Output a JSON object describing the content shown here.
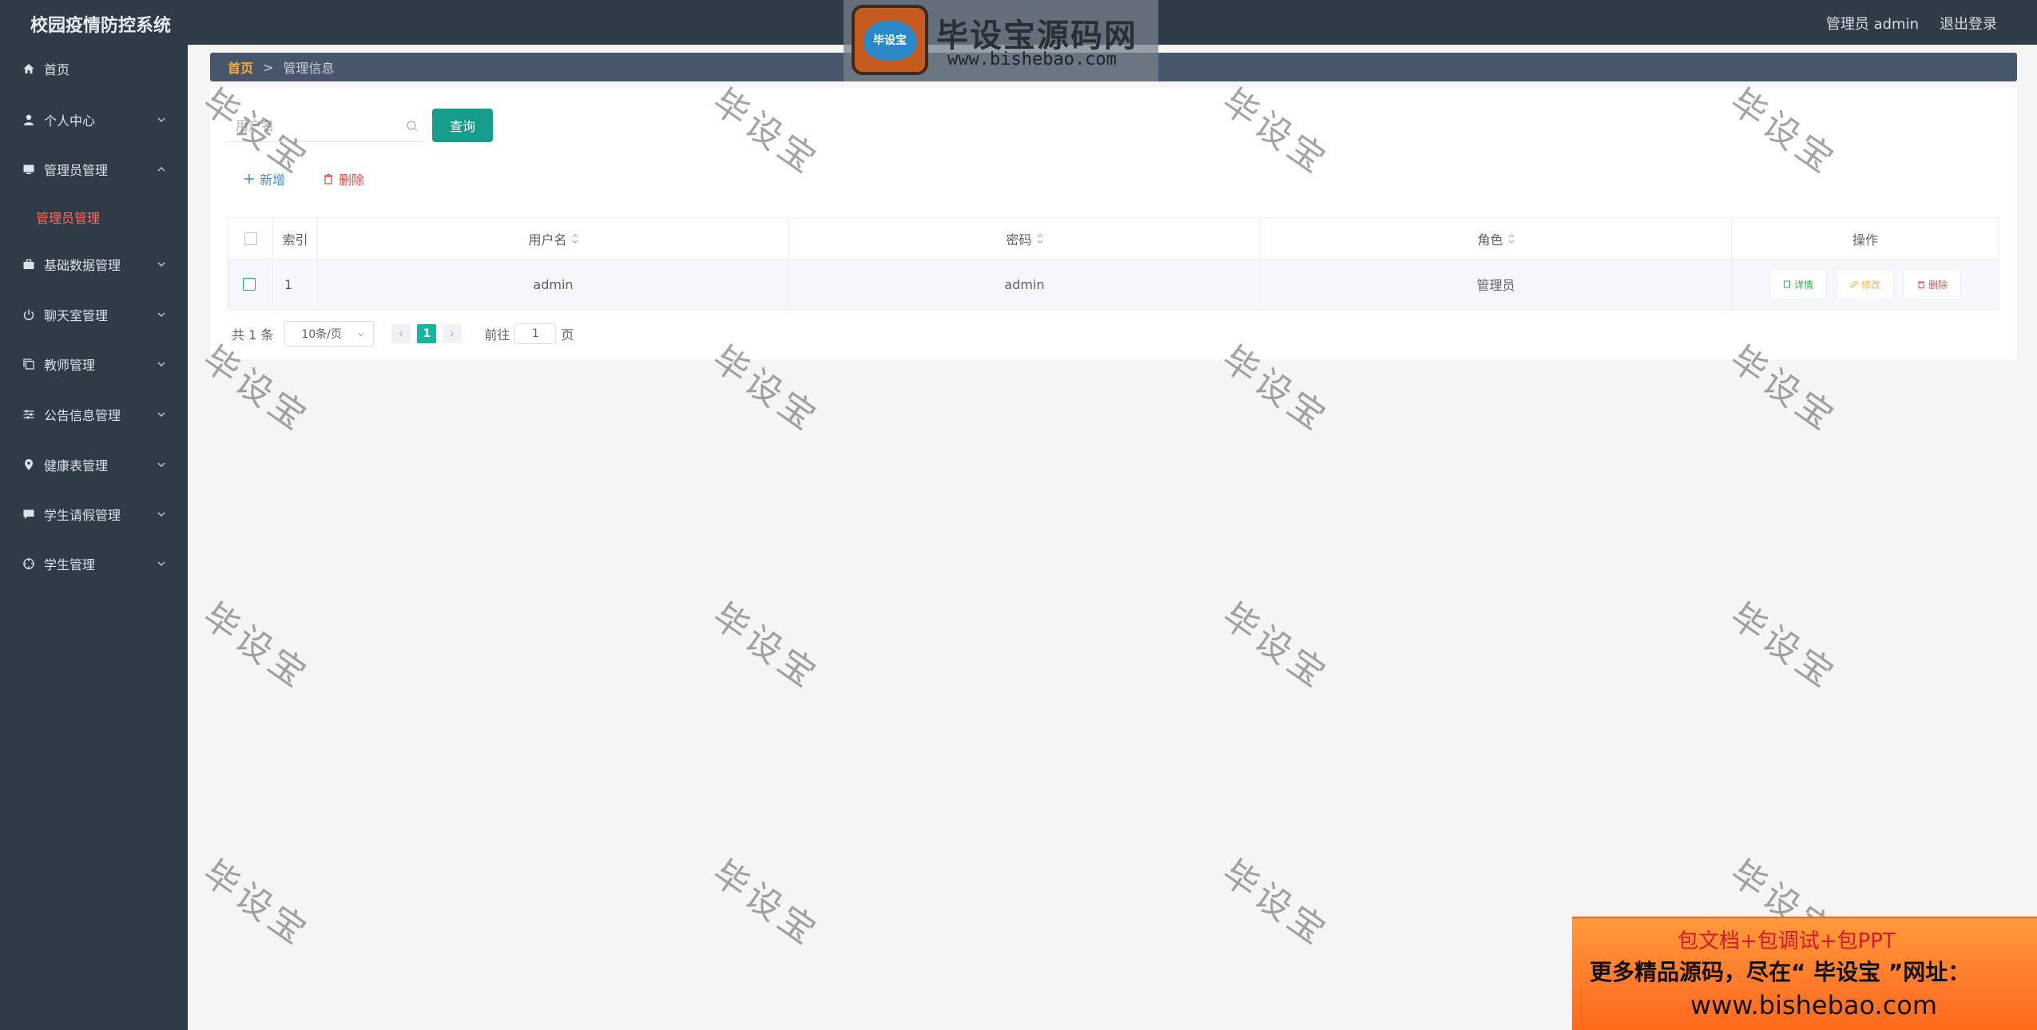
{
  "header": {
    "app_title": "校园疫情防控系统",
    "user_label": "管理员 admin",
    "logout_label": "退出登录"
  },
  "sidebar": {
    "items": [
      {
        "label": "首页",
        "icon": "home-icon",
        "has_chevron": false
      },
      {
        "label": "个人中心",
        "icon": "user-icon",
        "has_chevron": true
      },
      {
        "label": "管理员管理",
        "icon": "monitor-icon",
        "has_chevron": true,
        "expanded": true
      },
      {
        "label": "基础数据管理",
        "icon": "briefcase-icon",
        "has_chevron": true
      },
      {
        "label": "聊天室管理",
        "icon": "power-icon",
        "has_chevron": true
      },
      {
        "label": "教师管理",
        "icon": "copy-icon",
        "has_chevron": true
      },
      {
        "label": "公告信息管理",
        "icon": "sliders-icon",
        "has_chevron": true
      },
      {
        "label": "健康表管理",
        "icon": "location-icon",
        "has_chevron": true
      },
      {
        "label": "学生请假管理",
        "icon": "chat-icon",
        "has_chevron": true
      },
      {
        "label": "学生管理",
        "icon": "target-icon",
        "has_chevron": true
      }
    ],
    "submenu": {
      "label": "管理员管理"
    }
  },
  "breadcrumb": {
    "home": "首页",
    "separator": ">",
    "current": "管理信息"
  },
  "search": {
    "placeholder": "用户名",
    "value": "",
    "button_label": "查询"
  },
  "actions": {
    "add_label": "新增",
    "delete_label": "删除"
  },
  "table": {
    "columns": {
      "index": "索引",
      "username": "用户名",
      "password": "密码",
      "role": "角色",
      "operation": "操作"
    },
    "rows": [
      {
        "index": "1",
        "username": "admin",
        "password": "admin",
        "role": "管理员"
      }
    ],
    "row_actions": {
      "detail": "详情",
      "edit": "修改",
      "delete": "删除"
    }
  },
  "pagination": {
    "total": "共 1 条",
    "page_size": "10条/页",
    "current_page": "1",
    "goto_prefix": "前往",
    "goto_value": "1",
    "goto_suffix": "页"
  },
  "watermark": {
    "text": "毕设宝"
  },
  "logo": {
    "badge_text": "毕设宝",
    "title": "毕设宝源码网",
    "url": "www.bishebao.com"
  },
  "promo": {
    "line1": "包文档+包调试+包PPT",
    "line2": "更多精品源码，尽在“ 毕设宝 ”网址：",
    "line3": "www.bishebao.com"
  },
  "colors": {
    "sidebar_bg": "#2f3b47",
    "accent_teal": "#159c8b",
    "active_submenu": "#ff6b5b",
    "breadcrumb_home": "#f4a93c",
    "detail_green": "#3aa55a",
    "edit_orange": "#f2b64a",
    "delete_red": "#e05050"
  }
}
